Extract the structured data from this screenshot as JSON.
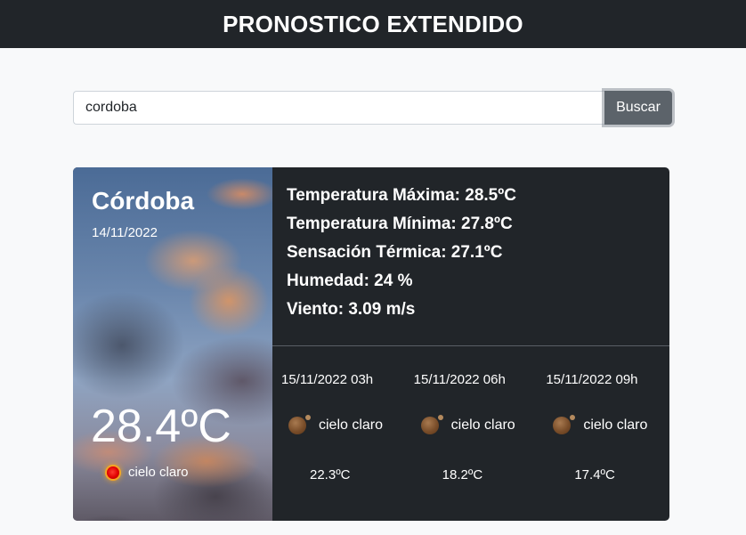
{
  "header": {
    "title": "PRONOSTICO EXTENDIDO"
  },
  "search": {
    "value": "cordoba",
    "button_label": "Buscar"
  },
  "current": {
    "city": "Córdoba",
    "date": "14/11/2022",
    "temp": "28.4ºC",
    "condition": "cielo claro",
    "icon": "clear-sky-day-icon"
  },
  "stats": {
    "max": "Temperatura Máxima: 28.5ºC",
    "min": "Temperatura Mínima: 27.8ºC",
    "feels": "Sensación Térmica: 27.1ºC",
    "humidity": "Humedad: 24 %",
    "wind": "Viento: 3.09 m/s"
  },
  "forecast": [
    {
      "datetime": "15/11/2022 03h",
      "condition": "cielo claro",
      "temp": "22.3ºC",
      "icon": "clear-sky-night-icon"
    },
    {
      "datetime": "15/11/2022 06h",
      "condition": "cielo claro",
      "temp": "18.2ºC",
      "icon": "clear-sky-night-icon"
    },
    {
      "datetime": "15/11/2022 09h",
      "condition": "cielo claro",
      "temp": "17.4ºC",
      "icon": "clear-sky-night-icon"
    }
  ],
  "colors": {
    "header_bg": "#212529",
    "card_bg": "#212529",
    "button_bg": "#5c636a",
    "page_bg": "#f8f9fa"
  }
}
